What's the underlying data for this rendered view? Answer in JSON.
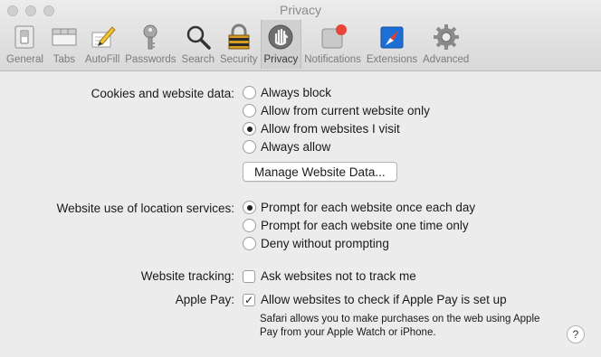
{
  "window": {
    "title": "Privacy"
  },
  "toolbar": {
    "tabs": [
      {
        "label": "General",
        "icon": "general-switch-icon"
      },
      {
        "label": "Tabs",
        "icon": "tabs-icon"
      },
      {
        "label": "AutoFill",
        "icon": "pencil-form-icon"
      },
      {
        "label": "Passwords",
        "icon": "key-icon"
      },
      {
        "label": "Search",
        "icon": "magnifier-icon"
      },
      {
        "label": "Security",
        "icon": "padlock-icon"
      },
      {
        "label": "Privacy",
        "icon": "hand-icon",
        "active": true
      },
      {
        "label": "Notifications",
        "icon": "notification-badge-icon"
      },
      {
        "label": "Extensions",
        "icon": "compass-puzzle-icon"
      },
      {
        "label": "Advanced",
        "icon": "gear-icon"
      }
    ]
  },
  "cookies": {
    "label": "Cookies and website data:",
    "options": [
      {
        "label": "Always block",
        "selected": false
      },
      {
        "label": "Allow from current website only",
        "selected": false
      },
      {
        "label": "Allow from websites I visit",
        "selected": true
      },
      {
        "label": "Always allow",
        "selected": false
      }
    ],
    "manage_button": "Manage Website Data..."
  },
  "location": {
    "label": "Website use of location services:",
    "options": [
      {
        "label": "Prompt for each website once each day",
        "selected": true
      },
      {
        "label": "Prompt for each website one time only",
        "selected": false
      },
      {
        "label": "Deny without prompting",
        "selected": false
      }
    ]
  },
  "tracking": {
    "label": "Website tracking:",
    "checkbox_label": "Ask websites not to track me",
    "checked": false
  },
  "applepay": {
    "label": "Apple Pay:",
    "checkbox_label": "Allow websites to check if Apple Pay is set up",
    "checked": true,
    "note": "Safari allows you to make purchases on the web using Apple Pay from your Apple Watch or iPhone."
  },
  "help": {
    "label": "?"
  },
  "colors": {
    "notification_badge": "#e8443a",
    "extensions_blue": "#1d6fd6"
  }
}
